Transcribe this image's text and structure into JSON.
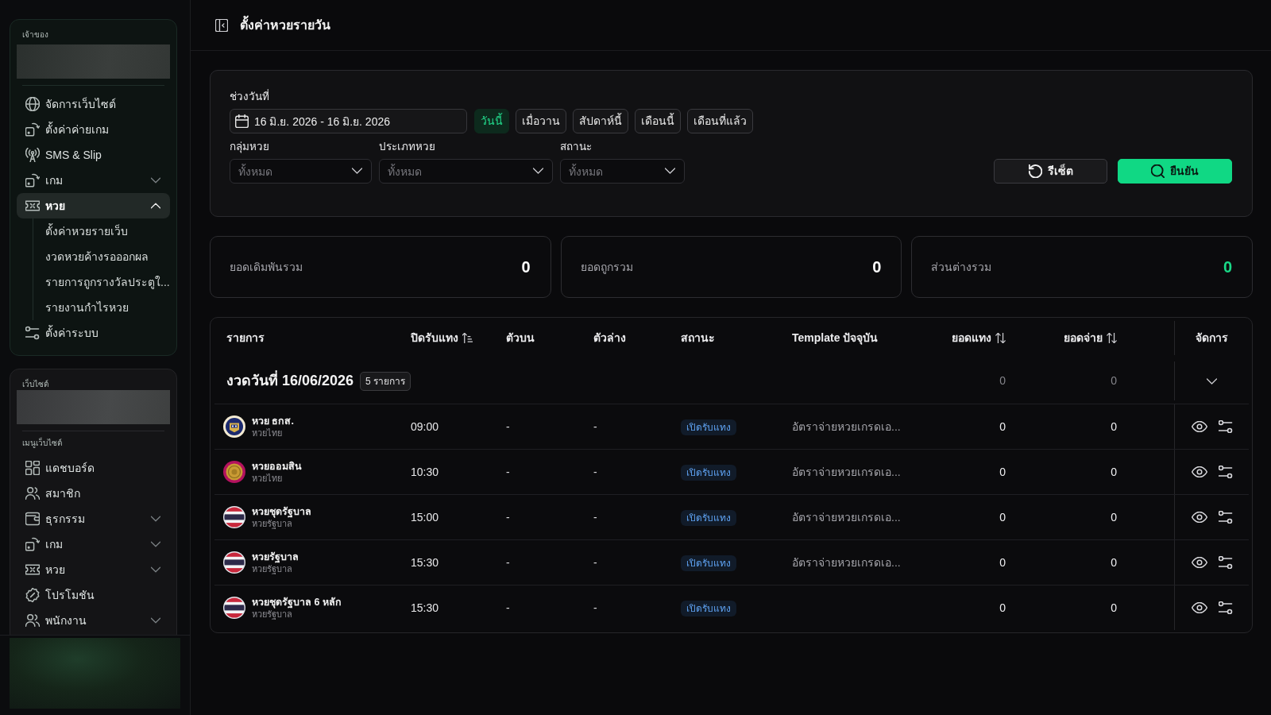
{
  "sidebar": {
    "owner_panel": {
      "label": "เจ้าของ",
      "items": [
        {
          "kind": "globe",
          "label": "จัดการเว็บไซต์",
          "selected": false
        },
        {
          "kind": "dice",
          "label": "ตั้งค่าค่ายเกม",
          "selected": false
        },
        {
          "kind": "antenna",
          "label": "SMS & Slip",
          "selected": false
        },
        {
          "kind": "dice",
          "label": "เกม",
          "selected": false,
          "expanded": false
        },
        {
          "kind": "ticket",
          "label": "หวย",
          "selected": true,
          "expanded": true,
          "children": [
            {
              "label": "ตั้งค่าหวยรายเว็บ",
              "selected": false
            },
            {
              "label": "งวดหวยค้างรอออกผล",
              "selected": false
            },
            {
              "label": "รายการถูกรางวัลประตูใ...",
              "selected": false
            },
            {
              "label": "รายงานกำไรหวย",
              "selected": false
            }
          ]
        },
        {
          "kind": "sliders",
          "label": "ตั้งค่าระบบ",
          "selected": false
        }
      ]
    },
    "website_panel": {
      "label": "เว็บไซต์",
      "menu_label": "เมนูเว็บไซต์",
      "items": [
        {
          "kind": "grid",
          "label": "แดชบอร์ด",
          "selected": false
        },
        {
          "kind": "users",
          "label": "สมาชิก",
          "selected": false
        },
        {
          "kind": "wallet",
          "label": "ธุรกรรม",
          "selected": false,
          "expanded": false
        },
        {
          "kind": "dice",
          "label": "เกม",
          "selected": false,
          "expanded": false
        },
        {
          "kind": "ticket",
          "label": "หวย",
          "selected": false,
          "expanded": false
        },
        {
          "kind": "percent",
          "label": "โปรโมชัน",
          "selected": false
        },
        {
          "kind": "users",
          "label": "พนักงาน",
          "selected": false,
          "expanded": false
        }
      ]
    }
  },
  "header": {
    "title": "ตั้งค่าหวยรายวัน"
  },
  "filters": {
    "date_range": {
      "label": "ช่วงวันที่",
      "value": "16 มิ.ย. 2026 - 16 มิ.ย. 2026"
    },
    "presets": [
      {
        "label": "วันนี้",
        "selected": true
      },
      {
        "label": "เมื่อวาน",
        "selected": false
      },
      {
        "label": "สัปดาห์นี้",
        "selected": false
      },
      {
        "label": "เดือนนี้",
        "selected": false
      },
      {
        "label": "เดือนที่แล้ว",
        "selected": false
      }
    ],
    "selects": [
      {
        "label": "กลุ่มหวย",
        "placeholder": "ทั้งหมด"
      },
      {
        "label": "ประเภทหวย",
        "placeholder": "ทั้งหมด"
      },
      {
        "label": "สถานะ",
        "placeholder": "ทั้งหมด"
      }
    ],
    "buttons": [
      {
        "kind": "reset",
        "label": "รีเซ็ต"
      },
      {
        "kind": "confirm",
        "label": "ยืนยัน"
      }
    ]
  },
  "summary": [
    {
      "label": "ยอดเดิมพันรวม",
      "value": "0",
      "color": "#ffffff"
    },
    {
      "label": "ยอดถูกรวม",
      "value": "0",
      "color": "#ffffff"
    },
    {
      "label": "ส่วนต่างรวม",
      "value": "0",
      "color": "#19d987"
    }
  ],
  "table": {
    "columns": [
      {
        "label": "รายการ"
      },
      {
        "label": "ปิดรับแทง",
        "sorted": true
      },
      {
        "label": "ตัวบน"
      },
      {
        "label": "ตัวล่าง"
      },
      {
        "label": "สถานะ"
      },
      {
        "label": "Template ปัจจุบัน"
      },
      {
        "label": "ยอดแทง",
        "sorted": false
      },
      {
        "label": "ยอดจ่าย",
        "sorted": false
      },
      {
        "label": "จัดการ"
      }
    ],
    "groups": [
      {
        "title": "งวดวันที่ 16/06/2026",
        "count": "5 รายการ",
        "bet_total": "0",
        "payout_total": "0",
        "rows": [
          {
            "kind": "emblem",
            "name": "หวย ธกส.",
            "category": "หวยไทย",
            "close_time": "09:00",
            "top": "-",
            "bottom": "-",
            "status": "เปิดรับแทง",
            "template": "อัตราจ่ายหวยเกรดเอ...",
            "bet": "0",
            "payout": "0"
          },
          {
            "kind": "seal",
            "name": "หวยออมสิน",
            "category": "หวยไทย",
            "close_time": "10:30",
            "top": "-",
            "bottom": "-",
            "status": "เปิดรับแทง",
            "template": "อัตราจ่ายหวยเกรดเอ...",
            "bet": "0",
            "payout": "0"
          },
          {
            "kind": "flag",
            "name": "หวยชุดรัฐบาล",
            "category": "หวยรัฐบาล",
            "close_time": "15:00",
            "top": "-",
            "bottom": "-",
            "status": "เปิดรับแทง",
            "template": "อัตราจ่ายหวยเกรดเอ...",
            "bet": "0",
            "payout": "0"
          },
          {
            "kind": "flag",
            "name": "หวยรัฐบาล",
            "category": "หวยรัฐบาล",
            "close_time": "15:30",
            "top": "-",
            "bottom": "-",
            "status": "เปิดรับแทง",
            "template": "อัตราจ่ายหวยเกรดเอ...",
            "bet": "0",
            "payout": "0"
          },
          {
            "kind": "flag",
            "name": "หวยชุดรัฐบาล 6 หลัก",
            "category": "หวยรัฐบาล",
            "close_time": "15:30",
            "top": "-",
            "bottom": "-",
            "status": "เปิดรับแทง",
            "bet": "0",
            "payout": "0"
          }
        ]
      }
    ]
  }
}
